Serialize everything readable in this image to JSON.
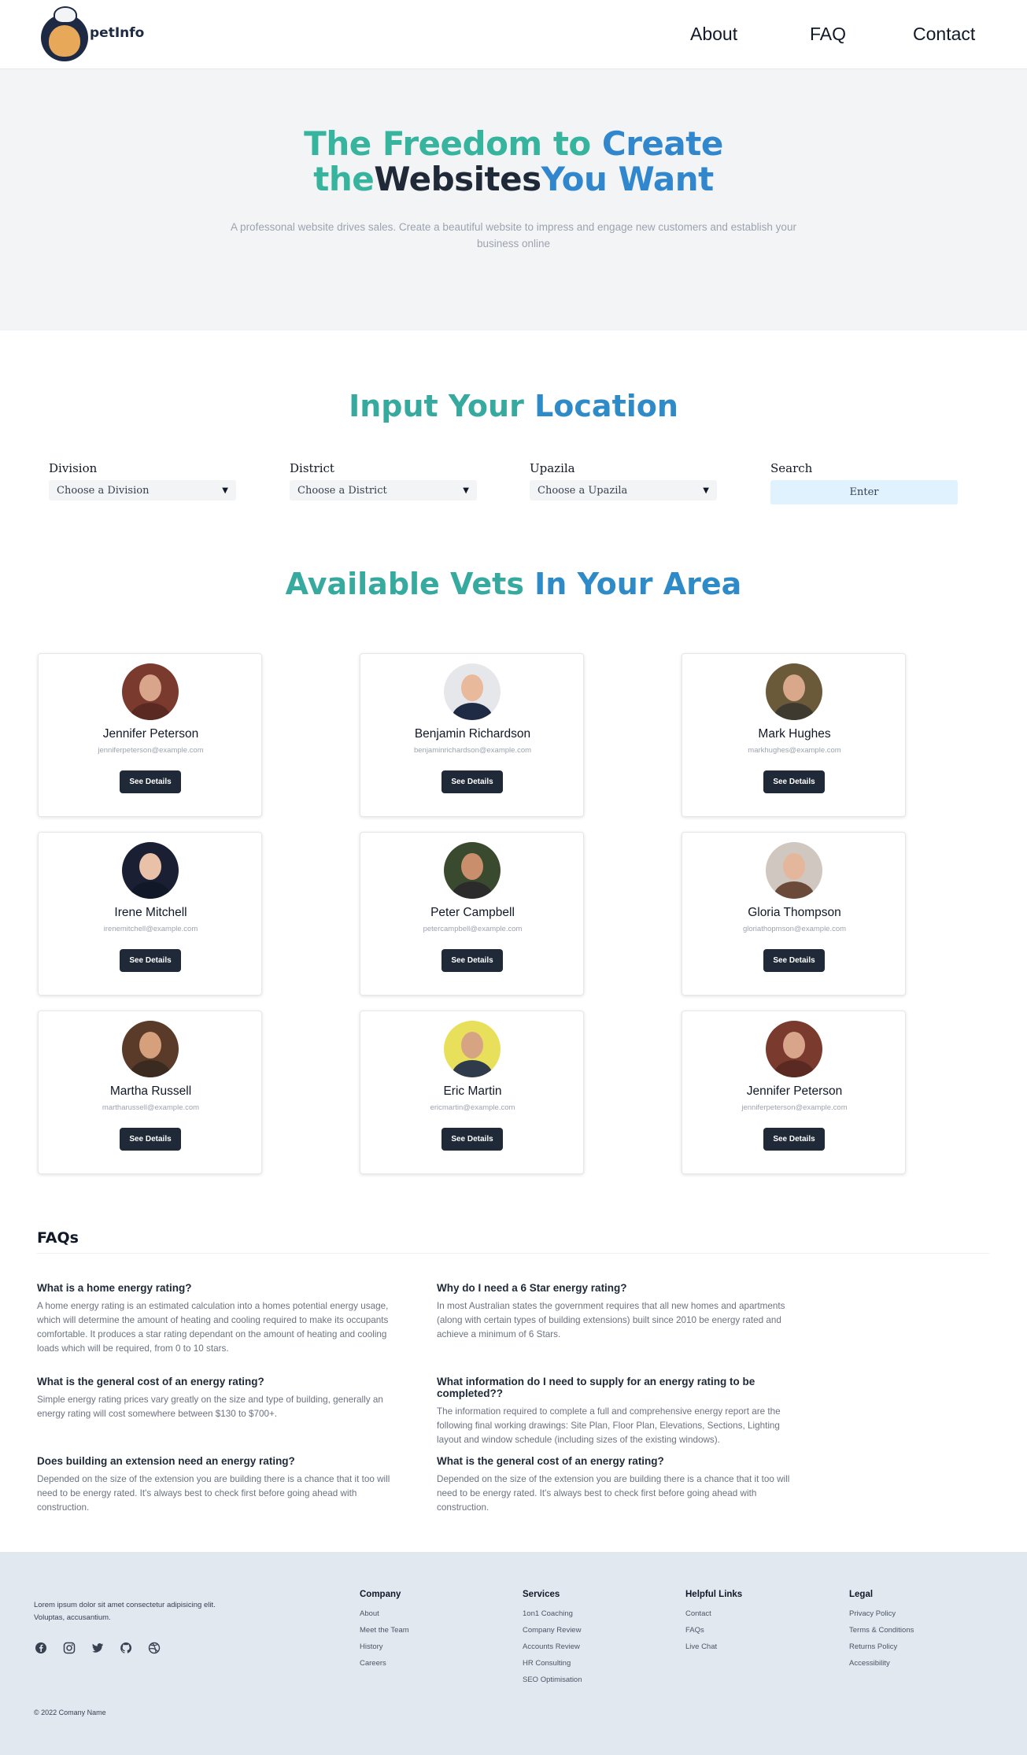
{
  "header": {
    "logo_text": "petInfo",
    "nav": [
      "About",
      "FAQ",
      "Contact"
    ]
  },
  "hero": {
    "title_line1_part1": "The Freedom to",
    "title_line1_part2": "Create",
    "title_line2_part1": "the",
    "title_line2_part2": "Websites",
    "title_line2_part3": "You Want",
    "subtitle": "A professonal website drives sales. Create a beautiful website to impress and engage new customers and establish your business online"
  },
  "location": {
    "title_part1": "Input Your",
    "title_part2": "Location",
    "division_label": "Division",
    "division_value": "Choose a Division",
    "district_label": "District",
    "district_value": "Choose a District",
    "upazila_label": "Upazila",
    "upazila_value": "Choose a Upazila",
    "search_label": "Search",
    "search_button": "Enter"
  },
  "vets": {
    "title_part1": "Available Vets",
    "title_part2": "In Your Area",
    "button_label": "See Details",
    "cards": [
      {
        "name": "Jennifer Peterson",
        "email": "jenniferpeterson@example.com"
      },
      {
        "name": "Benjamin Richardson",
        "email": "benjaminrichardson@example.com"
      },
      {
        "name": "Mark Hughes",
        "email": "markhughes@example.com"
      },
      {
        "name": "Irene Mitchell",
        "email": "irenemitchell@example.com"
      },
      {
        "name": "Peter Campbell",
        "email": "petercampbell@example.com"
      },
      {
        "name": "Gloria Thompson",
        "email": "gloriathopmson@example.com"
      },
      {
        "name": "Martha Russell",
        "email": "martharussell@example.com"
      },
      {
        "name": "Eric Martin",
        "email": "ericmartin@example.com"
      },
      {
        "name": "Jennifer Peterson",
        "email": "jenniferpeterson@example.com"
      }
    ]
  },
  "faq": {
    "title": "FAQs",
    "items": [
      {
        "q": "What is a home energy rating?",
        "a": "A home energy rating is an estimated calculation into a homes potential energy usage, which will determine the amount of heating and cooling required to make its occupants comfortable. It produces a star rating dependant on the amount of heating and cooling loads which will be required, from 0 to 10 stars."
      },
      {
        "q": "Why do I need a 6 Star energy rating?",
        "a": "In most Australian states the government requires that all new homes and apartments (along with certain types of building extensions) built since 2010 be energy rated and achieve a minimum of 6 Stars."
      },
      {
        "q": "What is the general cost of an energy rating?",
        "a": "Simple energy rating prices vary greatly on the size and type of building, generally an energy rating will cost somewhere between $130 to $700+."
      },
      {
        "q": "What information do I need to supply for an energy rating to be completed??",
        "a": "The information required to complete a full and comprehensive energy report are the following final working drawings: Site Plan, Floor Plan, Elevations, Sections, Lighting layout and window schedule (including sizes of the existing windows)."
      },
      {
        "q": "Does building an extension need an energy rating?",
        "a": "Depended on the size of the extension you are building there is a chance that it too will need to be energy rated. It's always best to check first before going ahead with construction."
      },
      {
        "q": "What is the general cost of an energy rating?",
        "a": "Depended on the size of the extension you are building there is a chance that it too will need to be energy rated. It's always best to check first before going ahead with construction."
      }
    ]
  },
  "footer": {
    "about": "Lorem ipsum dolor sit amet consectetur adipisicing elit. Voluptas, accusantium.",
    "socials": [
      "facebook-icon",
      "instagram-icon",
      "twitter-icon",
      "github-icon",
      "dribbble-icon"
    ],
    "columns": [
      {
        "title": "Company",
        "links": [
          "About",
          "Meet the Team",
          "History",
          "Careers"
        ]
      },
      {
        "title": "Services",
        "links": [
          "1on1 Coaching",
          "Company Review",
          "Accounts Review",
          "HR Consulting",
          "SEO Optimisation"
        ]
      },
      {
        "title": "Helpful Links",
        "links": [
          "Contact",
          "FAQs",
          "Live Chat"
        ]
      },
      {
        "title": "Legal",
        "links": [
          "Privacy Policy",
          "Terms & Conditions",
          "Returns Policy",
          "Accessibility"
        ]
      }
    ],
    "copyright": "© 2022 Comany Name"
  }
}
